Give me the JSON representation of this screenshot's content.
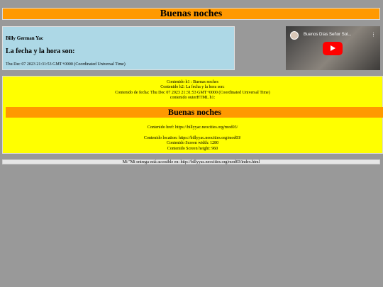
{
  "header": {
    "title": "Buenas noches"
  },
  "info": {
    "name": "Billy German Yac",
    "subtitle": "La fecha y la hora son:",
    "datetime": "Thu Dec 07 2023 21:31:53 GMT+0000 (Coordinated Universal Time)"
  },
  "video": {
    "title": "Buenos Días Señor Sol...",
    "menu_icon": "more-vert-icon",
    "play_icon": "youtube-play-icon"
  },
  "content": {
    "h1_line": "Contenido h1 : Buenas noches",
    "h2_line": "Contenido h2: La fecha y la hora son:",
    "fecha_line": "Contenido de fecha: Thu Dec 07 2023 21:31:53 GMT+0000 (Coordinated Universal Time)",
    "outer_line": "contenido outerHTML h1:",
    "inner_h1": "Buenas noches",
    "href_line": "Contenido href: https://billyyac.neocities.org/mod03/",
    "location_line": "Contenido location: https://billyyac.neocities.org/mod03/",
    "width_line": "Contenido Screen width: 1280",
    "height_line": "Contenido Screen height: 960"
  },
  "footer": {
    "text": "Mi \"Mi entrega está accesible en: http://billyyac.neocities.org/mod03/index.html"
  },
  "colors": {
    "background": "#999999",
    "orange": "#ff9900",
    "lightblue": "#add8e6",
    "yellow": "#ffff00"
  }
}
